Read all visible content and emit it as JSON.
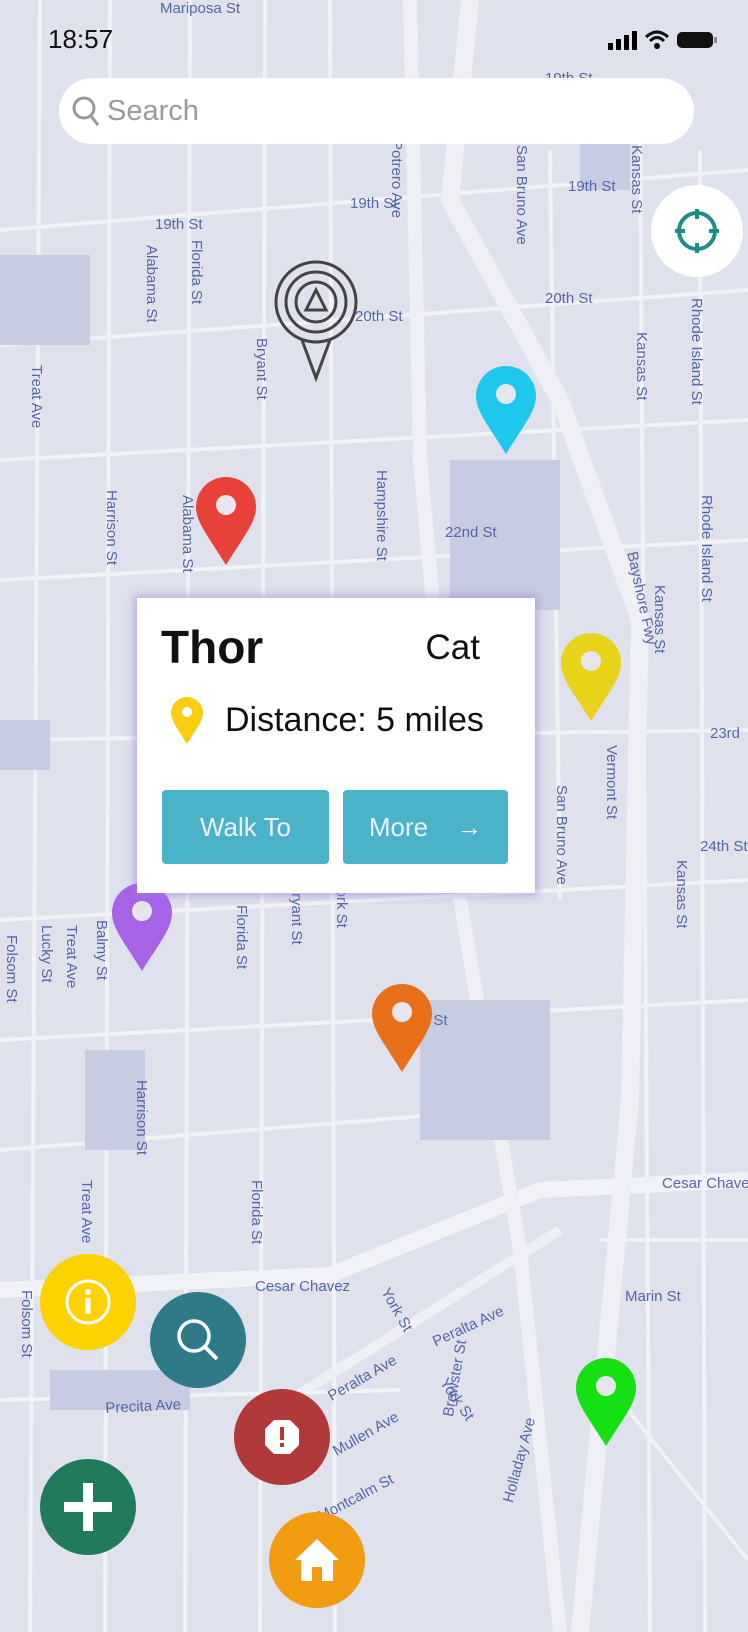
{
  "status_bar": {
    "time": "18:57"
  },
  "search": {
    "placeholder": "Search"
  },
  "map": {
    "street_labels": [
      "Mariposa St",
      "19th St",
      "19th St",
      "19th St",
      "19th St",
      "20th St",
      "20th St",
      "22nd St",
      "23rd",
      "24th St",
      "25th St",
      "Cesar Chavez",
      "Cesar Chave",
      "Marin St",
      "Peralta Ave",
      "Peralta Ave",
      "Precita Ave",
      "Mullen Ave",
      "Montcalm St",
      "York St",
      "York St",
      "York St",
      "Bryant St",
      "Bryant St",
      "Alabama St",
      "Alabama St",
      "Florida St",
      "Florida St",
      "Florida St",
      "Harrison St",
      "Harrison St",
      "Treat Ave",
      "Treat Ave",
      "Treat Ave",
      "Hampshire St",
      "San Bruno Ave",
      "San Bruno Ave",
      "Kansas St",
      "Kansas St",
      "Kansas St",
      "Kansas St",
      "Rhode Island St",
      "Rhode Island St",
      "Vermont St",
      "Bayshore Fwy",
      "Folsom St",
      "Folsom St",
      "Lucky St",
      "Balmy St",
      "Brewster St",
      "Holladay Ave",
      "Potrero Ave"
    ],
    "pin_colors": [
      "#1ec8ec",
      "#e8413a",
      "#e8d21a",
      "#a663e8",
      "#e8701a",
      "#14e014"
    ]
  },
  "popup": {
    "name": "Thor",
    "type": "Cat",
    "distance": "Distance: 5 miles",
    "walk_label": "Walk To",
    "more_label": "More",
    "more_arrow": "→"
  },
  "colors": {
    "accent": "#4bb3c8",
    "info": "#fcd200",
    "search": "#2e7a87",
    "alert": "#b03a39",
    "add": "#217a5c",
    "home": "#f29c12",
    "locate": "#1f8c88"
  }
}
